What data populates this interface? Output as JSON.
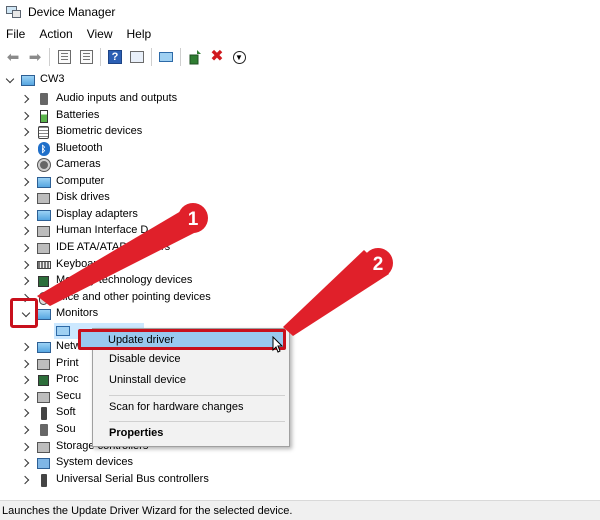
{
  "window": {
    "title": "Device Manager"
  },
  "menu": {
    "items": [
      "File",
      "Action",
      "View",
      "Help"
    ]
  },
  "toolbar": {
    "icons": [
      "back-arrow-icon",
      "forward-arrow-icon",
      "show-hide-console-tree-icon",
      "properties-sheet-icon",
      "help-icon",
      "action-pane-icon",
      "scan-hardware-icon",
      "update-driver-icon",
      "uninstall-device-icon",
      "disable-device-icon"
    ]
  },
  "tree": {
    "root": "CW3",
    "categories": [
      "Audio inputs and outputs",
      "Batteries",
      "Biometric devices",
      "Bluetooth",
      "Cameras",
      "Computer",
      "Disk drives",
      "Display adapters",
      "Human Interface D",
      "IDE ATA/ATAPI co",
      "Keyboar",
      "Memory technology devices",
      "Mice and other pointing devices",
      "Monitors",
      "Netw",
      "Print",
      "Proc",
      "Secu",
      "Soft",
      "Sou",
      "Storage controllers",
      "System devices",
      "Universal Serial Bus controllers"
    ],
    "ide_suffix": "llers"
  },
  "context_menu": {
    "items": [
      "Update driver",
      "Disable device",
      "Uninstall device",
      "Scan for hardware changes",
      "Properties"
    ]
  },
  "annotations": {
    "badge_1": "1",
    "badge_2": "2"
  },
  "status": {
    "text": "Launches the Update Driver Wizard for the selected device."
  },
  "colors": {
    "callout_red": "#e0202a",
    "outline_red": "#c8101c",
    "highlight_blue": "#99c9ef",
    "selection_blue": "#cce8ff"
  }
}
